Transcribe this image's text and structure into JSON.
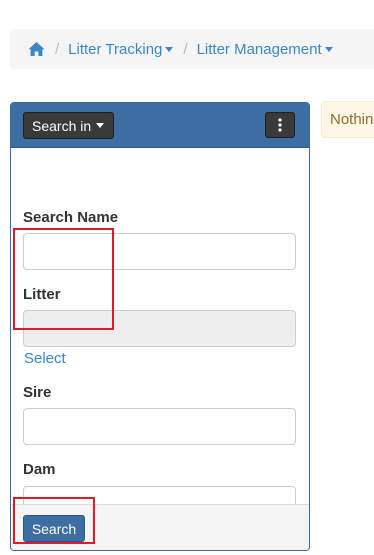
{
  "breadcrumb": {
    "home_icon": "home-icon",
    "items": [
      {
        "label": "Litter Tracking"
      },
      {
        "label": "Litter Management"
      }
    ],
    "separator": "/"
  },
  "alert": {
    "text": "Nothing found"
  },
  "panel": {
    "search_in_label": "Search in",
    "menu_icon": "vertical-ellipsis-icon",
    "fields": {
      "search_name": {
        "label": "Search Name",
        "value": ""
      },
      "litter": {
        "label": "Litter",
        "value": "",
        "select_link": "Select"
      },
      "sire": {
        "label": "Sire",
        "value": ""
      },
      "dam": {
        "label": "Dam",
        "value": ""
      }
    },
    "search_button": "Search"
  },
  "colors": {
    "panel_header": "#3d6ea3",
    "link": "#3a87c8",
    "highlight": "#e01b24",
    "alert_bg": "#fcf8e3"
  }
}
